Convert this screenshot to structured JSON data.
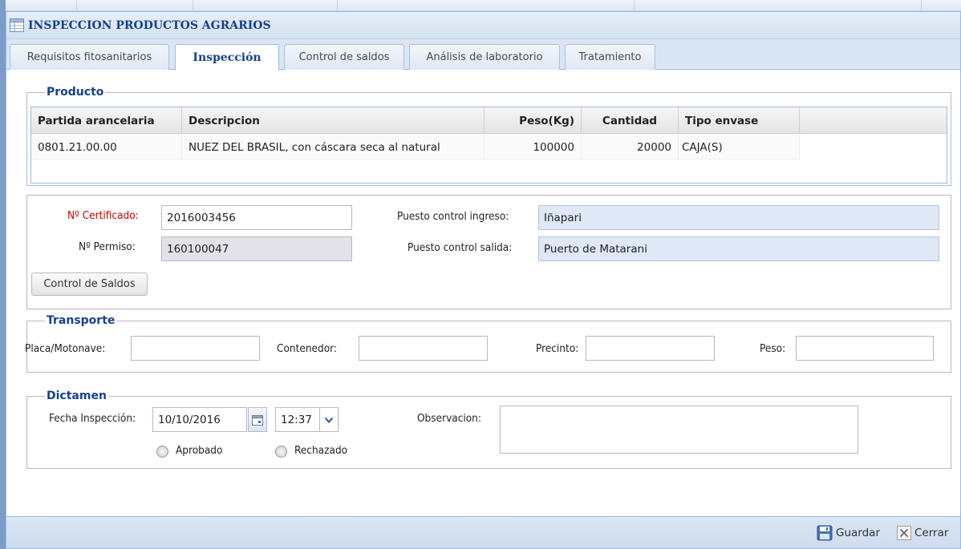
{
  "window": {
    "title": "INSPECCION PRODUCTOS AGRARIOS"
  },
  "tabs": [
    {
      "label": "Requisitos fitosanitarios",
      "active": false
    },
    {
      "label": "Inspección",
      "active": true
    },
    {
      "label": "Control de saldos",
      "active": false
    },
    {
      "label": "Análisis de laboratorio",
      "active": false
    },
    {
      "label": "Tratamiento",
      "active": false
    }
  ],
  "producto": {
    "legend": "Producto",
    "columns": [
      "Partida arancelaria",
      "Descripcion",
      "Peso(Kg)",
      "Cantidad",
      "Tipo envase"
    ],
    "rows": [
      [
        "0801.21.00.00",
        "NUEZ DEL BRASIL, con cáscara seca al natural",
        "100000",
        "20000",
        "CAJA(S)"
      ]
    ]
  },
  "certificado": {
    "cert_label": "Nº Certificado:",
    "cert_value": "2016003456",
    "permiso_label": "Nº Permiso:",
    "permiso_value": "160100047",
    "ingreso_label": "Puesto control ingreso:",
    "ingreso_value": "Iñapari",
    "salida_label": "Puesto control salida:",
    "salida_value": "Puerto de Matarani",
    "control_button": "Control de Saldos",
    "colors": {
      "required_label": "#cc0000"
    }
  },
  "transporte": {
    "legend": "Transporte",
    "placa_label": "Placa/Motonave:",
    "placa_value": "",
    "contenedor_label": "Contenedor:",
    "contenedor_value": "",
    "precinto_label": "Precinto:",
    "precinto_value": "",
    "peso_label": "Peso:",
    "peso_value": ""
  },
  "dictamen": {
    "legend": "Dictamen",
    "fecha_label": "Fecha Inspección:",
    "fecha_value": "10/10/2016",
    "hora_value": "12:37",
    "observacion_label": "Observacion:",
    "observacion_value": "",
    "aprobado_label": "Aprobado",
    "rechazado_label": "Rechazado",
    "aprobado_checked": false,
    "rechazado_checked": false
  },
  "footer": {
    "save_label": "Guardar",
    "close_label": "Cerrar"
  },
  "icons": {
    "title": "grid-window-icon",
    "calendar": "calendar-icon",
    "dropdown": "chevron-down-icon",
    "save": "floppy-disk-icon",
    "close": "close-x-icon"
  },
  "theme": {
    "accent": "#15428b",
    "panel_border": "#99bbe8",
    "header_bg": "#dbe6f4"
  }
}
